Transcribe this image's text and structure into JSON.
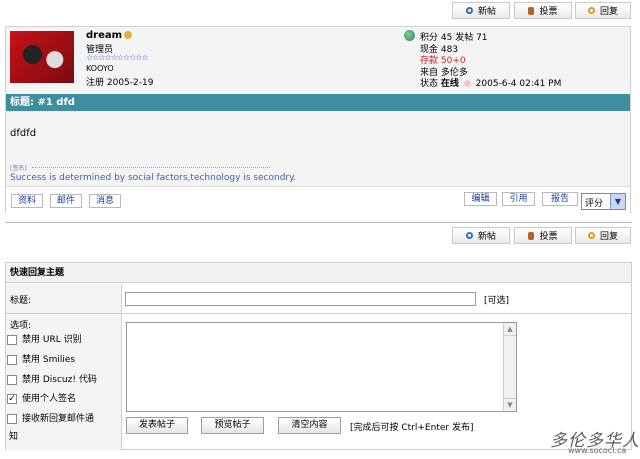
{
  "toolbar": {
    "new_post": "新帖",
    "vote": "投票",
    "reply": "回复"
  },
  "post": {
    "author": "dream",
    "role": "管理员",
    "stars": "☆☆☆☆☆☆☆☆☆☆",
    "group_tag": "KOOYO",
    "registered": "注册 2005-2-19",
    "stats": {
      "points": "积分 45",
      "posts": "发帖 71",
      "cash": "现金 483",
      "deposit": "存款 50+0",
      "from": "来自 多伦多",
      "status_label": "状态",
      "status_value": "在线",
      "time": "2005-6-4 02:41 PM"
    },
    "title": "标题: #1  dfd",
    "body": "dfdfd",
    "sig_label": "[签名]",
    "signature": "Success is determined by social factors,technology is secondry.",
    "actions_left": [
      "资料",
      "邮件",
      "消息"
    ],
    "actions_right": [
      "编辑",
      "引用",
      "报告"
    ],
    "rating_label": "评分"
  },
  "quick_reply": {
    "header": "快速回复主题",
    "title_label": "标题:",
    "optional_label": "[可选]",
    "options_label": "选项:",
    "options": [
      {
        "label": "禁用 URL 识别",
        "checked": false
      },
      {
        "label": "禁用 Smilies",
        "checked": false
      },
      {
        "label": "禁用 Discuz! 代码",
        "checked": false
      },
      {
        "label": "使用个人签名",
        "checked": true
      },
      {
        "label": "接收新回复邮件通",
        "checked": false
      }
    ],
    "option_wrap": "知",
    "submit": "发表帖子",
    "preview": "预览帖子",
    "clear": "清空内容",
    "hint": "[完成后可按 Ctrl+Enter 发布]"
  },
  "watermark": {
    "text": "多伦多华人",
    "url": "www.sococl.ca"
  }
}
